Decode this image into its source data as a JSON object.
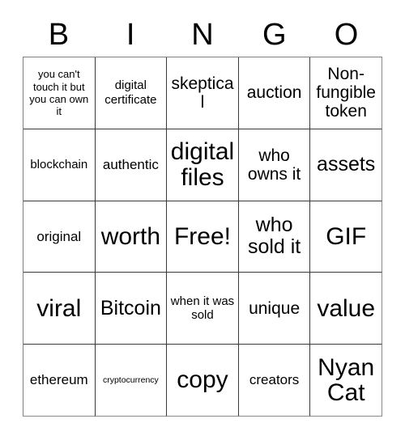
{
  "header": {
    "letters": [
      "B",
      "I",
      "N",
      "G",
      "O"
    ]
  },
  "grid": {
    "rows": 5,
    "columns": 5,
    "border_color": "#3a3a3a",
    "background_color": "#ffffff",
    "text_color": "#000000",
    "cells": [
      [
        {
          "text": "you can't touch it but you can own it",
          "size": "xs"
        },
        {
          "text": "digital certificate",
          "size": "sm"
        },
        {
          "text": "skeptical",
          "size": "lg"
        },
        {
          "text": "auction",
          "size": "lg"
        },
        {
          "text": "Non-fungible token",
          "size": "lg"
        }
      ],
      [
        {
          "text": "blockchain",
          "size": "sm"
        },
        {
          "text": "authentic",
          "size": "md"
        },
        {
          "text": "digital files",
          "size": "xxl"
        },
        {
          "text": "who owns it",
          "size": "lg"
        },
        {
          "text": "assets",
          "size": "xl"
        }
      ],
      [
        {
          "text": "original",
          "size": "md"
        },
        {
          "text": "worth",
          "size": "xxl"
        },
        {
          "text": "Free!",
          "size": "xxl"
        },
        {
          "text": "who sold it",
          "size": "xl"
        },
        {
          "text": "GIF",
          "size": "xxl"
        }
      ],
      [
        {
          "text": "viral",
          "size": "xxl"
        },
        {
          "text": "Bitcoin",
          "size": "xl"
        },
        {
          "text": "when it was sold",
          "size": "sm"
        },
        {
          "text": "unique",
          "size": "lg"
        },
        {
          "text": "value",
          "size": "xxl"
        }
      ],
      [
        {
          "text": "ethereum",
          "size": "md"
        },
        {
          "text": "cryptocurrency",
          "size": "xxs"
        },
        {
          "text": "copy",
          "size": "xxl"
        },
        {
          "text": "creators",
          "size": "md"
        },
        {
          "text": "Nyan Cat",
          "size": "xxl"
        }
      ]
    ]
  }
}
